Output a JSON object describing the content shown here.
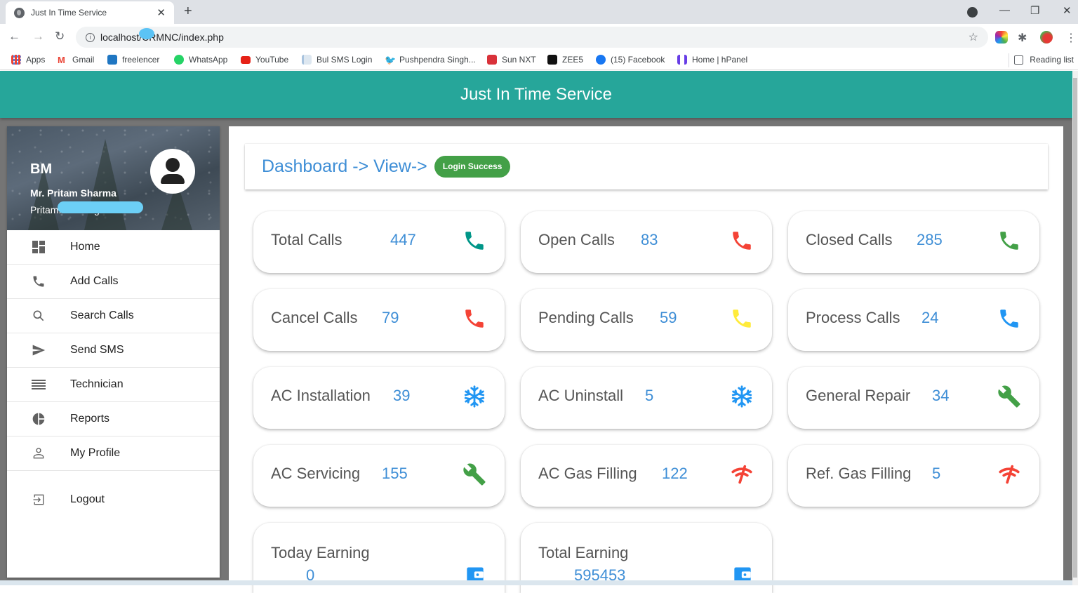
{
  "browser": {
    "tab_title": "Just In Time Service",
    "url": "localhost/CRMNC/index.php",
    "bookmarks": [
      {
        "label": "Apps",
        "icon": "apps-grid-icon",
        "color": "#4285f4"
      },
      {
        "label": "Gmail",
        "icon": "gmail-icon",
        "color": "#ea4335"
      },
      {
        "label": "freelencer",
        "icon": "freelancer-icon",
        "color": "#1f76c2"
      },
      {
        "label": "WhatsApp",
        "icon": "whatsapp-icon",
        "color": "#25d366"
      },
      {
        "label": "YouTube",
        "icon": "youtube-icon",
        "color": "#e62117"
      },
      {
        "label": "Bul SMS Login",
        "icon": "document-icon",
        "color": "#a8c3de"
      },
      {
        "label": "Pushpendra Singh...",
        "icon": "twitter-icon",
        "color": "#1da1f2"
      },
      {
        "label": "Sun NXT",
        "icon": "sunnxt-icon",
        "color": "#d9323a"
      },
      {
        "label": "ZEE5",
        "icon": "zee5-icon",
        "color": "#111111"
      },
      {
        "label": "(15) Facebook",
        "icon": "facebook-icon",
        "color": "#1877f2"
      },
      {
        "label": "Home | hPanel",
        "icon": "hostinger-icon",
        "color": "#673de6"
      }
    ],
    "reading_list": "Reading list"
  },
  "header": {
    "title": "Just In Time Service",
    "color": "#26a69a"
  },
  "sidebar": {
    "user": {
      "initials": "BM",
      "name": "Mr. Pritam Sharma",
      "email": "Pritam.............gmail.com"
    },
    "items": [
      {
        "label": "Home",
        "icon": "dashboard-icon"
      },
      {
        "label": "Add Calls",
        "icon": "phone-icon"
      },
      {
        "label": "Search Calls",
        "icon": "search-icon"
      },
      {
        "label": "Send SMS",
        "icon": "send-icon"
      },
      {
        "label": "Technician",
        "icon": "list-icon"
      },
      {
        "label": "Reports",
        "icon": "pie-chart-icon"
      },
      {
        "label": "My Profile",
        "icon": "person-icon"
      },
      {
        "label": "Logout",
        "icon": "logout-icon"
      }
    ]
  },
  "main": {
    "breadcrumb": "Dashboard -> View->",
    "badge": "Login Success",
    "badge_color": "#43a047",
    "stats": [
      {
        "label": "Total Calls",
        "value": "447",
        "icon": "phone-icon",
        "color": "#009688"
      },
      {
        "label": "Open Calls",
        "value": "83",
        "icon": "phone-icon",
        "color": "#f44336"
      },
      {
        "label": "Closed Calls",
        "value": "285",
        "icon": "phone-icon",
        "color": "#43a047"
      },
      {
        "label": "Cancel Calls",
        "value": "79",
        "icon": "phone-icon",
        "color": "#f44336"
      },
      {
        "label": "Pending Calls",
        "value": "59",
        "icon": "phone-icon",
        "color": "#ffeb3b"
      },
      {
        "label": "Process Calls",
        "value": "24",
        "icon": "phone-icon",
        "color": "#2196f3"
      },
      {
        "label": "AC Installation",
        "value": "39",
        "icon": "snowflake-icon",
        "color": "#2196f3"
      },
      {
        "label": "AC Uninstall",
        "value": "5",
        "icon": "snowflake-icon",
        "color": "#2196f3"
      },
      {
        "label": "General Repair",
        "value": "34",
        "icon": "wrench-icon",
        "color": "#43a047"
      },
      {
        "label": "AC Servicing",
        "value": "155",
        "icon": "wrench-icon",
        "color": "#43a047"
      },
      {
        "label": "AC Gas Filling",
        "value": "122",
        "icon": "signal-off-icon",
        "color": "#f44336"
      },
      {
        "label": "Ref. Gas Filling",
        "value": "5",
        "icon": "signal-off-icon",
        "color": "#f44336"
      }
    ],
    "earnings": [
      {
        "label": "Today Earning",
        "value": "0",
        "icon": "wallet-icon",
        "color": "#2196f3"
      },
      {
        "label": "Total Earning",
        "value": "595453",
        "icon": "wallet-icon",
        "color": "#2196f3"
      }
    ]
  }
}
